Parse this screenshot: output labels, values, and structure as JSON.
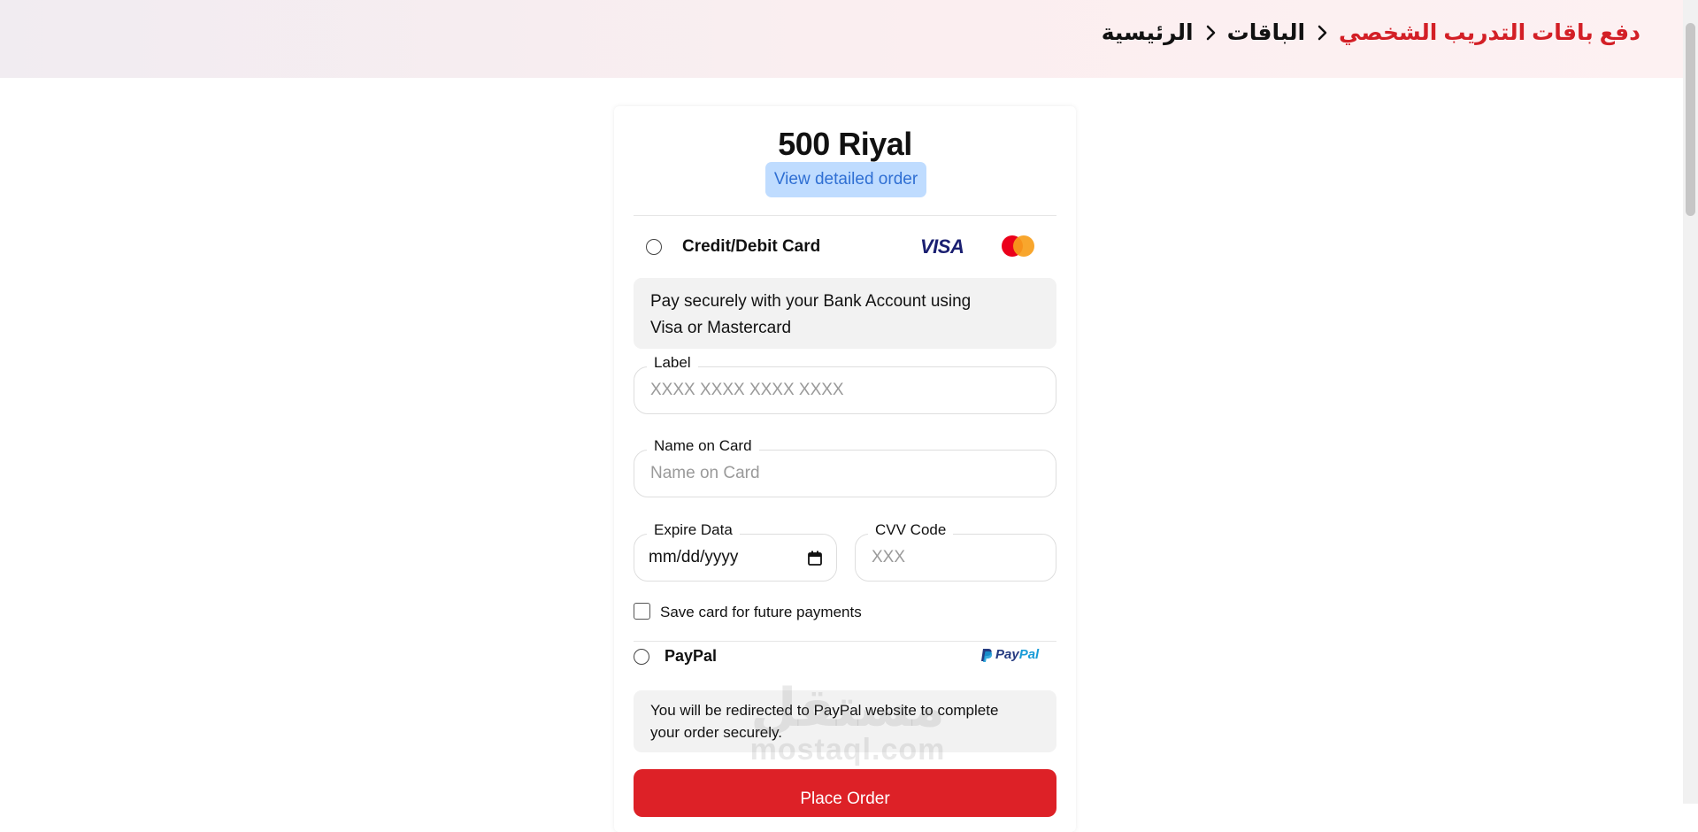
{
  "breadcrumb": {
    "home": "الرئيسية",
    "packages": "الباقات",
    "current": "دفع باقات التدريب الشخصي"
  },
  "order": {
    "price": "500 Riyal",
    "view_details": "View detailed order"
  },
  "card_option": {
    "label": "Credit/Debit Card",
    "brand_visa": "VISA",
    "info_line1": "Pay securely with your Bank Account using",
    "info_line2": "Visa or Mastercard",
    "card_number_label": "Label",
    "card_number_placeholder": "XXXX XXXX XXXX XXXX",
    "name_label": "Name on Card",
    "name_placeholder": "Name on Card",
    "expiry_label": "Expire Data",
    "expiry_value": "mm/dd/yyyy",
    "cvv_label": "CVV Code",
    "cvv_placeholder": "XXX",
    "save_card_label": "Save card for future payments"
  },
  "paypal_option": {
    "label": "PayPal",
    "logo_pay": "Pay",
    "logo_pal": "Pal",
    "info_line1": "You will be redirected to PayPal website to complete",
    "info_line2": "your order securely."
  },
  "actions": {
    "place_order": "Place Order"
  },
  "watermark": {
    "logo": "مستقل",
    "site": "mostaql.com"
  },
  "colors": {
    "accent_red": "#dd2127",
    "breadcrumb_active": "#d31f26",
    "link_blue": "#2f6fd3",
    "link_bg": "#bfdcff"
  }
}
